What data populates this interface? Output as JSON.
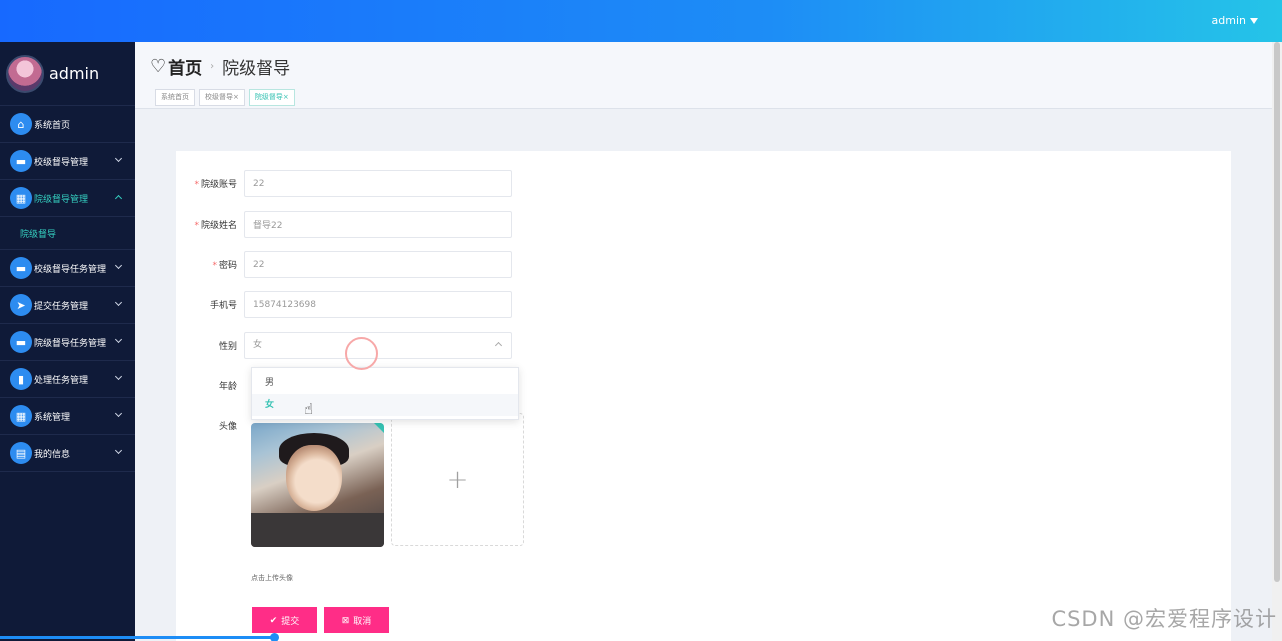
{
  "topbar": {
    "user": "admin"
  },
  "sidebar": {
    "brand": "admin",
    "items": [
      {
        "label": "系统首页",
        "icon": "home-icon",
        "glyph": "⌂",
        "has_arrow": false
      },
      {
        "label": "校级督导管理",
        "icon": "monitor-icon",
        "glyph": "▬",
        "has_arrow": true
      },
      {
        "label": "院级督导管理",
        "icon": "grid-icon",
        "glyph": "▦",
        "has_arrow": true,
        "active": true
      },
      {
        "label": "校级督导任务管理",
        "icon": "monitor-icon",
        "glyph": "▬",
        "has_arrow": true
      },
      {
        "label": "提交任务管理",
        "icon": "send-icon",
        "glyph": "➤",
        "has_arrow": true
      },
      {
        "label": "院级督导任务管理",
        "icon": "monitor-icon",
        "glyph": "▬",
        "has_arrow": true
      },
      {
        "label": "处理任务管理",
        "icon": "chart-icon",
        "glyph": "▮",
        "has_arrow": true
      },
      {
        "label": "系统管理",
        "icon": "grid-icon",
        "glyph": "▦",
        "has_arrow": true
      },
      {
        "label": "我的信息",
        "icon": "card-icon",
        "glyph": "▤",
        "has_arrow": true
      }
    ],
    "sub_item": "院级督导"
  },
  "breadcrumb": {
    "home": "首页",
    "current": "院级督导"
  },
  "tags": [
    {
      "label": "系统首页"
    },
    {
      "label": "校级督导×"
    },
    {
      "label": "院级督导×"
    }
  ],
  "form": {
    "account_label": "院级账号",
    "account_value": "22",
    "name_label": "院级姓名",
    "name_value": "督导22",
    "password_label": "密码",
    "password_value": "22",
    "phone_label": "手机号",
    "phone_value": "15874123698",
    "gender_label": "性别",
    "gender_value": "女",
    "age_label": "年龄",
    "avatar_label": "头像",
    "gender_options": [
      "男",
      "女"
    ],
    "upload_hint": "点击上传头像",
    "submit_label": "提交",
    "cancel_label": "取消"
  },
  "watermark": "CSDN @宏爱程序设计",
  "colors": {
    "accent": "#35c2b3",
    "button": "#ff2d87",
    "sidebar": "#0f1a38",
    "topbar": "#1769ff"
  }
}
